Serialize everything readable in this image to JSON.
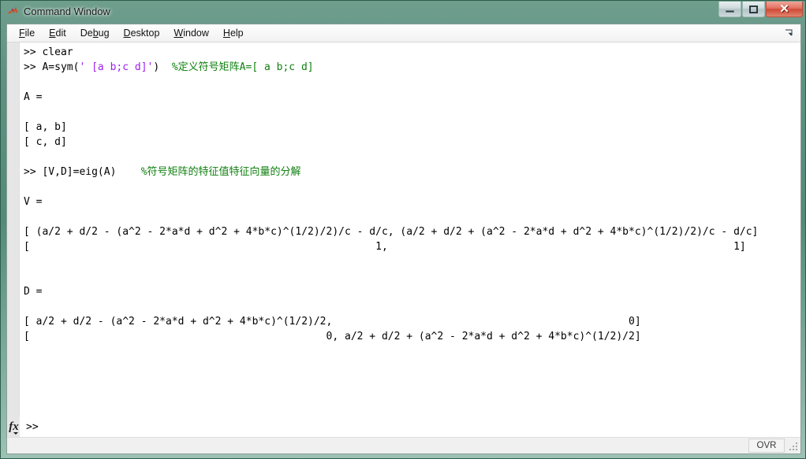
{
  "window": {
    "title": "Command Window",
    "app_icon": "matlab-icon",
    "buttons": {
      "minimize": "minimize-button",
      "maximize": "maximize-button",
      "close": "✕"
    }
  },
  "menubar": {
    "items": [
      {
        "label": "File",
        "mnemonic": "F"
      },
      {
        "label": "Edit",
        "mnemonic": "E"
      },
      {
        "label": "Debug",
        "mnemonic": "b"
      },
      {
        "label": "Desktop",
        "mnemonic": "D"
      },
      {
        "label": "Window",
        "mnemonic": "W"
      },
      {
        "label": "Help",
        "mnemonic": "H"
      }
    ],
    "dock_arrow": "dock-arrow-icon"
  },
  "console": {
    "lines": [
      {
        "segments": [
          {
            "text": ">> clear",
            "type": "plain"
          }
        ]
      },
      {
        "segments": [
          {
            "text": ">> A=sym(",
            "type": "plain"
          },
          {
            "text": "' [a b;c d]'",
            "type": "string"
          },
          {
            "text": ")  ",
            "type": "plain"
          },
          {
            "text": "%定义符号矩阵A=[ a b;c d]",
            "type": "comment"
          }
        ]
      },
      {
        "segments": [
          {
            "text": "",
            "type": "plain"
          }
        ]
      },
      {
        "segments": [
          {
            "text": "A =",
            "type": "plain"
          }
        ]
      },
      {
        "segments": [
          {
            "text": "",
            "type": "plain"
          }
        ]
      },
      {
        "segments": [
          {
            "text": "[ a, b]",
            "type": "plain"
          }
        ]
      },
      {
        "segments": [
          {
            "text": "[ c, d]",
            "type": "plain"
          }
        ]
      },
      {
        "segments": [
          {
            "text": "",
            "type": "plain"
          }
        ]
      },
      {
        "segments": [
          {
            "text": ">> [V,D]=eig(A)    ",
            "type": "plain"
          },
          {
            "text": "%符号矩阵的特征值特征向量的分解",
            "type": "comment"
          }
        ]
      },
      {
        "segments": [
          {
            "text": "",
            "type": "plain"
          }
        ]
      },
      {
        "segments": [
          {
            "text": "V =",
            "type": "plain"
          }
        ]
      },
      {
        "segments": [
          {
            "text": "",
            "type": "plain"
          }
        ]
      },
      {
        "segments": [
          {
            "text": "[ (a/2 + d/2 - (a^2 - 2*a*d + d^2 + 4*b*c)^(1/2)/2)/c - d/c, (a/2 + d/2 + (a^2 - 2*a*d + d^2 + 4*b*c)^(1/2)/2)/c - d/c]",
            "type": "plain"
          }
        ]
      },
      {
        "segments": [
          {
            "text": "[                                                        1,                                                        1]",
            "type": "plain"
          }
        ]
      },
      {
        "segments": [
          {
            "text": "",
            "type": "plain"
          }
        ]
      },
      {
        "segments": [
          {
            "text": "",
            "type": "plain"
          }
        ]
      },
      {
        "segments": [
          {
            "text": "D =",
            "type": "plain"
          }
        ]
      },
      {
        "segments": [
          {
            "text": "",
            "type": "plain"
          }
        ]
      },
      {
        "segments": [
          {
            "text": "[ a/2 + d/2 - (a^2 - 2*a*d + d^2 + 4*b*c)^(1/2)/2,                                                0]",
            "type": "plain"
          }
        ]
      },
      {
        "segments": [
          {
            "text": "[                                                0, a/2 + d/2 + (a^2 - 2*a*d + d^2 + 4*b*c)^(1/2)/2]",
            "type": "plain"
          }
        ]
      }
    ],
    "fx_label": "fx",
    "fx_icon": "function-browser-icon",
    "active_prompt": ">>"
  },
  "statusbar": {
    "overwrite_mode": "OVR",
    "grip": "resize-grip-icon"
  },
  "colors": {
    "string_token": "#a020f0",
    "comment_token": "#108010",
    "text": "#000000",
    "console_background": "#ffffff",
    "titlebar": "#538a78",
    "close_button": "#cf4a34"
  }
}
